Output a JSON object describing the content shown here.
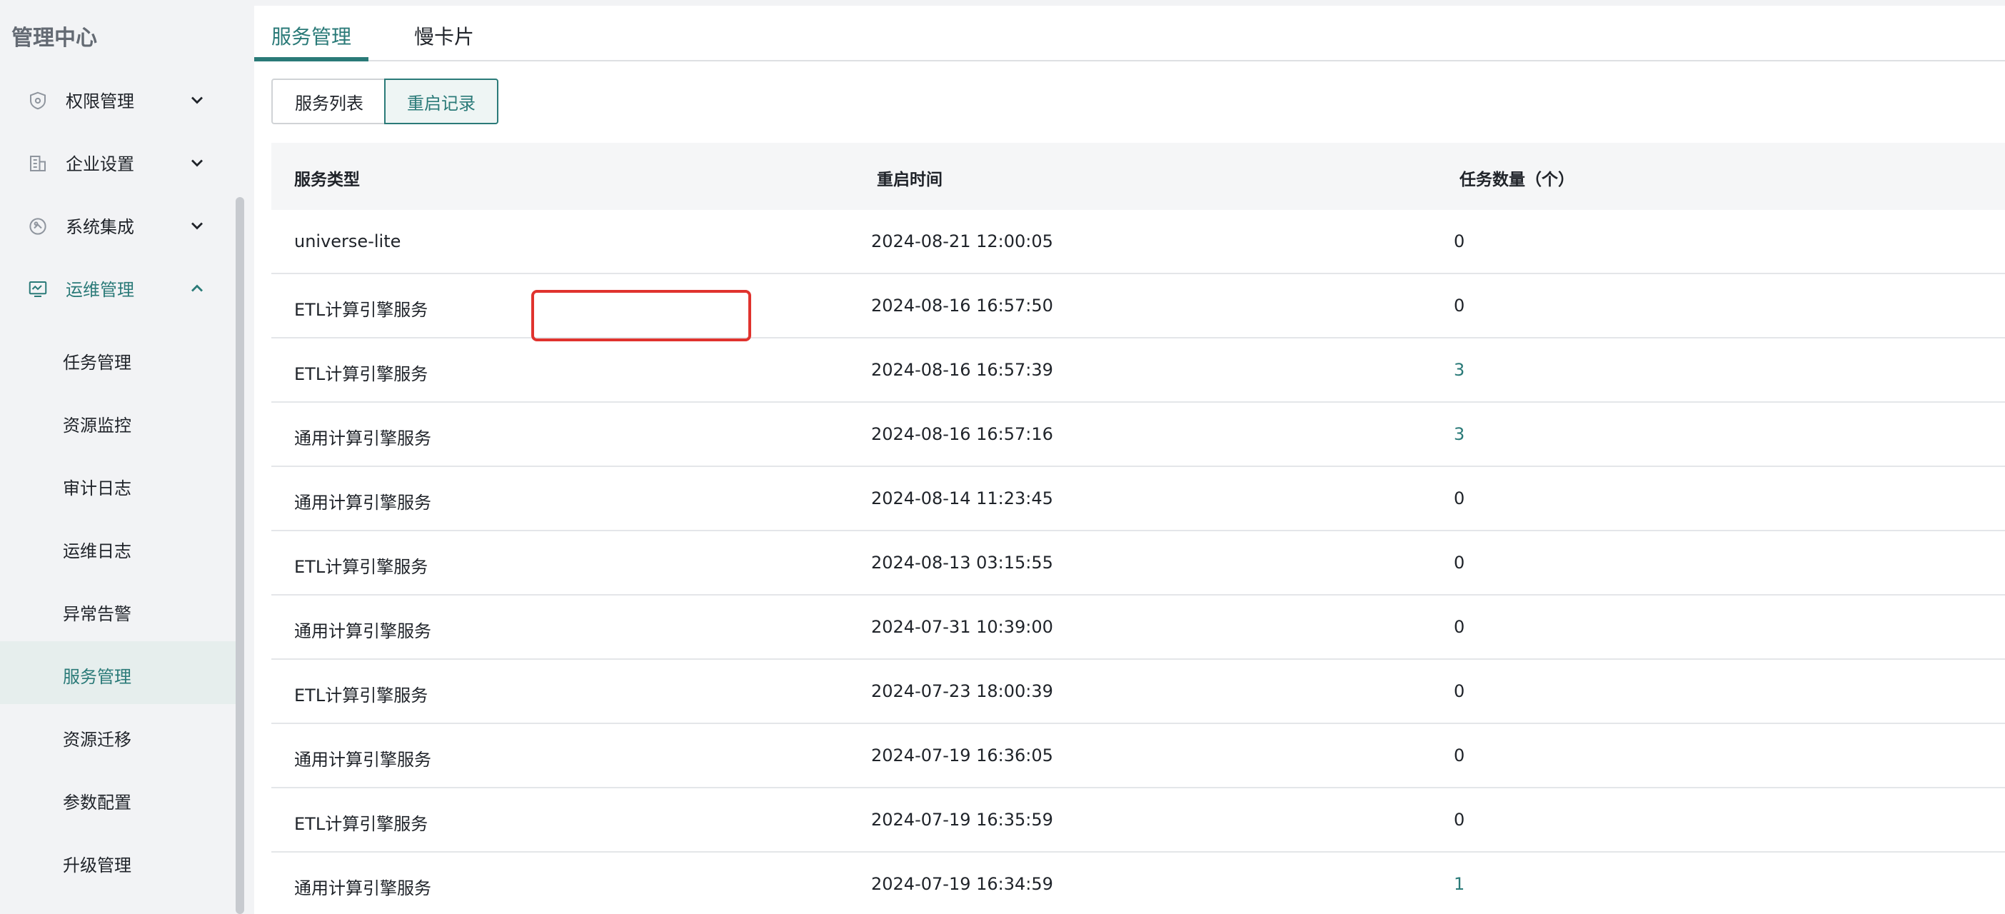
{
  "sidebar": {
    "title": "管理中心",
    "groups": [
      {
        "label": "权限管理",
        "icon": "shield-icon",
        "expanded": false
      },
      {
        "label": "企业设置",
        "icon": "building-icon",
        "expanded": false
      },
      {
        "label": "系统集成",
        "icon": "integration-icon",
        "expanded": false
      },
      {
        "label": "运维管理",
        "icon": "monitor-icon",
        "expanded": true
      }
    ],
    "sub_items": [
      {
        "label": "任务管理"
      },
      {
        "label": "资源监控"
      },
      {
        "label": "审计日志"
      },
      {
        "label": "运维日志"
      },
      {
        "label": "异常告警"
      },
      {
        "label": "服务管理",
        "active": true
      },
      {
        "label": "资源迁移"
      },
      {
        "label": "参数配置"
      },
      {
        "label": "升级管理"
      }
    ]
  },
  "tabs": [
    {
      "label": "服务管理",
      "active": true
    },
    {
      "label": "慢卡片",
      "active": false
    }
  ],
  "segments": [
    {
      "label": "服务列表",
      "active": false
    },
    {
      "label": "重启记录",
      "active": true
    }
  ],
  "table": {
    "headers": [
      "服务类型",
      "重启时间",
      "任务数量（个）"
    ],
    "rows": [
      {
        "type": "universe-lite",
        "time": "2024-08-21 12:00:05",
        "count": "0"
      },
      {
        "type": "ETL计算引擎服务",
        "time": "2024-08-16 16:57:50",
        "count": "0"
      },
      {
        "type": "ETL计算引擎服务",
        "time": "2024-08-16 16:57:39",
        "count": "3"
      },
      {
        "type": "通用计算引擎服务",
        "time": "2024-08-16 16:57:16",
        "count": "3"
      },
      {
        "type": "通用计算引擎服务",
        "time": "2024-08-14 11:23:45",
        "count": "0"
      },
      {
        "type": "ETL计算引擎服务",
        "time": "2024-08-13 03:15:55",
        "count": "0"
      },
      {
        "type": "通用计算引擎服务",
        "time": "2024-07-31 10:39:00",
        "count": "0"
      },
      {
        "type": "ETL计算引擎服务",
        "time": "2024-07-23 18:00:39",
        "count": "0"
      },
      {
        "type": "通用计算引擎服务",
        "time": "2024-07-19 16:36:05",
        "count": "0"
      },
      {
        "type": "ETL计算引擎服务",
        "time": "2024-07-19 16:35:59",
        "count": "0"
      },
      {
        "type": "通用计算引擎服务",
        "time": "2024-07-19 16:34:59",
        "count": "1"
      }
    ]
  },
  "colors": {
    "accent": "#2a7a78",
    "highlight": "#e0332e"
  }
}
